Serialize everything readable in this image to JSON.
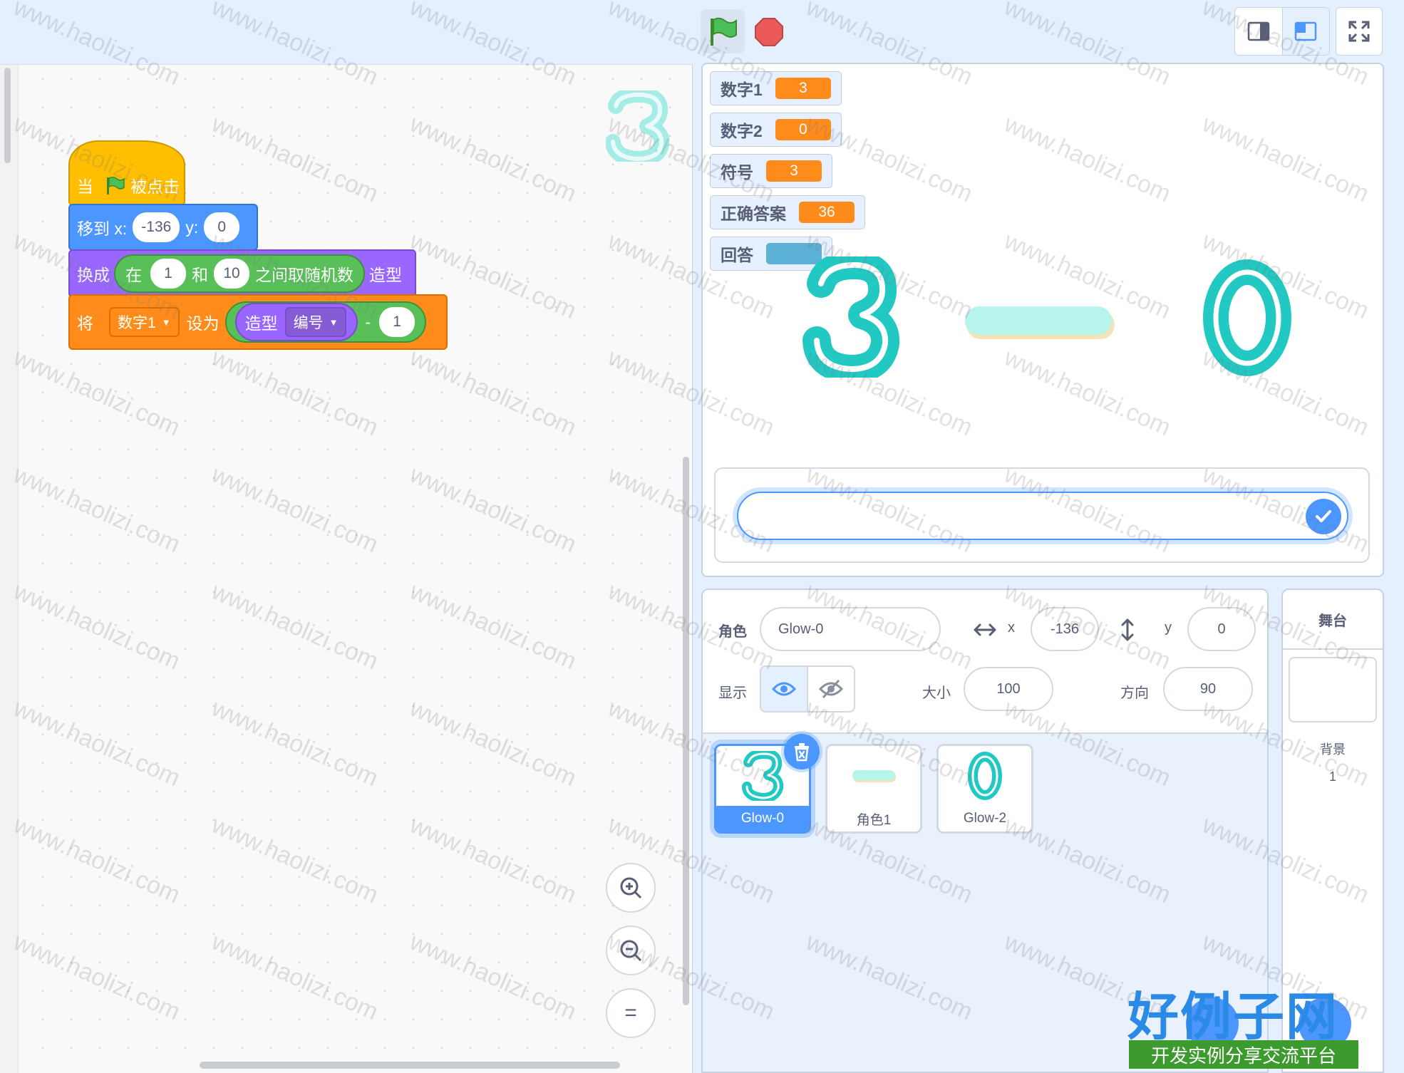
{
  "topbar": {
    "green_flag_icon": "green-flag-icon",
    "stop_icon": "stop-icon",
    "layout_small_icon": "small-stage-icon",
    "layout_normal_icon": "normal-stage-icon",
    "fullscreen_icon": "fullscreen-icon"
  },
  "code": {
    "hat": {
      "when": "当",
      "clicked": "被点击"
    },
    "goto": {
      "label": "移到 x:",
      "x": "-136",
      "y_label": "y:",
      "y": "0"
    },
    "switch": {
      "label": "换成",
      "rand_in": "在",
      "from": "1",
      "and": "和",
      "to": "10",
      "rand_end": "之间取随机数",
      "costume": "造型"
    },
    "set": {
      "label": "将",
      "var": "数字1",
      "to": "设为",
      "costume_word": "造型",
      "number_dd": "编号",
      "minus": "-",
      "minus_val": "1"
    },
    "zoom_in_icon": "zoom-in-icon",
    "zoom_out_icon": "zoom-out-icon",
    "zoom_reset_icon": "zoom-reset-icon",
    "zoom_reset_glyph": "="
  },
  "stage": {
    "monitors": [
      {
        "name": "数字1",
        "value": "3"
      },
      {
        "name": "数字2",
        "value": "0"
      },
      {
        "name": "符号",
        "value": "3"
      },
      {
        "name": "正确答案",
        "value": "36"
      },
      {
        "name": "回答",
        "value": ""
      }
    ],
    "ask_value": ""
  },
  "sprite_info": {
    "sprite_label": "角色",
    "sprite_name": "Glow-0",
    "x_label": "x",
    "x": "-136",
    "y_label": "y",
    "y": "0",
    "show_label": "显示",
    "size_label": "大小",
    "size": "100",
    "direction_label": "方向",
    "direction": "90"
  },
  "sprites": [
    {
      "name": "Glow-0",
      "selected": true
    },
    {
      "name": "角色1",
      "selected": false
    },
    {
      "name": "Glow-2",
      "selected": false
    }
  ],
  "stage_pane": {
    "title": "舞台",
    "backdrops_label": "背景",
    "backdrops_count": "1"
  },
  "watermark": {
    "text": "www.haolizi.com",
    "logo_big": "好例子网",
    "logo_sub": "开发实例分享交流平台"
  },
  "colors": {
    "events": "#ffbf00",
    "motion": "#4c97ff",
    "looks": "#9966ff",
    "operators": "#59c059",
    "variables": "#ff8c1a",
    "accent": "#4c97ff",
    "glyph_teal": "#22c9c3"
  }
}
